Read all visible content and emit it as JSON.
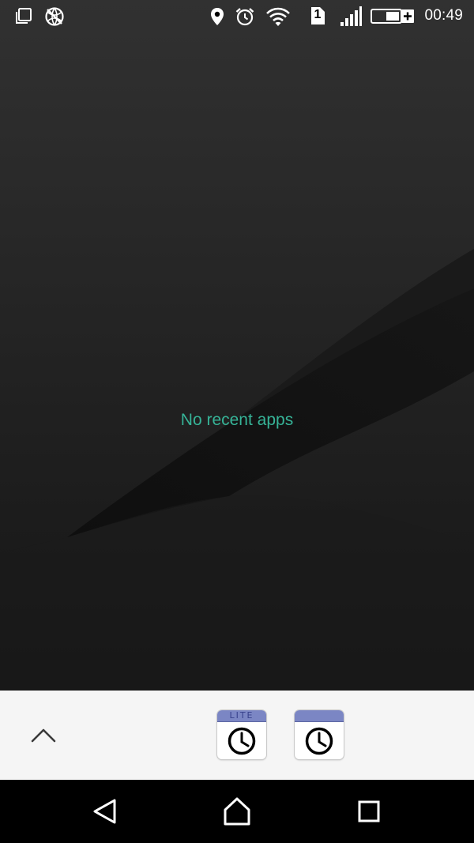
{
  "status_bar": {
    "time": "00:49",
    "sim_slot": "1",
    "icons": [
      "screen-mirror-icon",
      "data-saver-icon",
      "location-icon",
      "alarm-icon",
      "wifi-icon",
      "sim-card-icon",
      "signal-icon",
      "battery-charging-icon"
    ]
  },
  "recents": {
    "empty_message": "No recent apps"
  },
  "app_tray": {
    "expand_icon": "chevron-up-icon",
    "apps": [
      {
        "header_label": "LITE",
        "icon": "clock-icon",
        "header_color": "#7b86c4"
      },
      {
        "header_label": "",
        "icon": "clock-icon",
        "header_color": "#7b86c4"
      }
    ]
  },
  "navigation": {
    "buttons": [
      "back-icon",
      "home-icon",
      "recents-icon"
    ]
  },
  "colors": {
    "accent_text": "#36b397",
    "tray_background": "#f5f5f5",
    "wallpaper": "#1e1e1e"
  }
}
